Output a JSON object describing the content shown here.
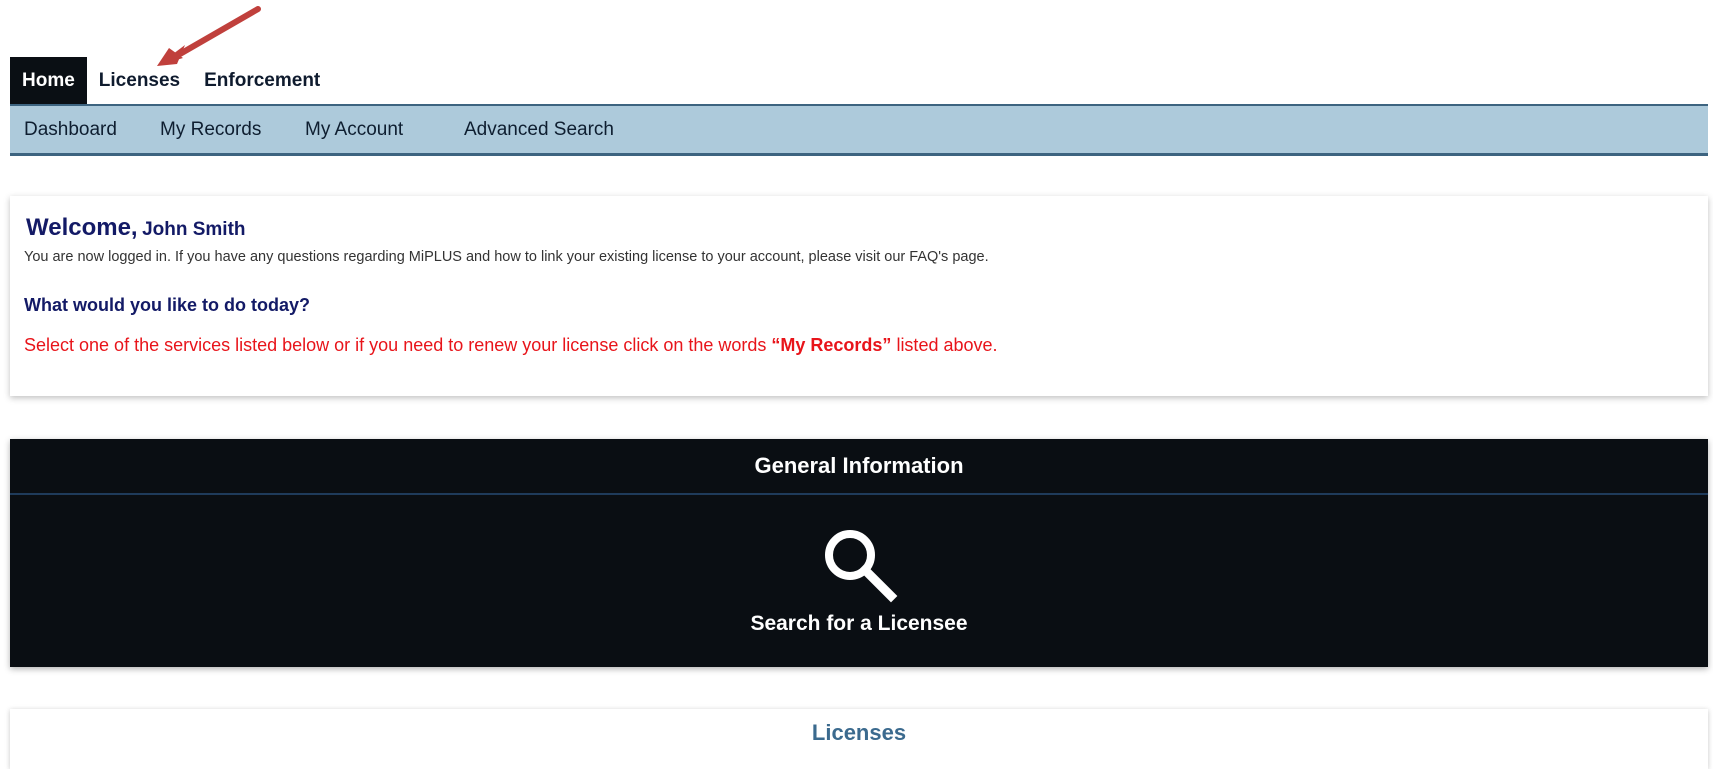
{
  "top_tabs": [
    "Home",
    "Licenses",
    "Enforcement"
  ],
  "sub_nav": [
    "Dashboard",
    "My Records",
    "My Account",
    "Advanced Search"
  ],
  "welcome": {
    "greeting": "Welcome,",
    "name": "John Smith",
    "message": "You are now logged in. If you have any questions regarding MiPLUS and how to link your existing license to your account, please visit our FAQ's page.",
    "question": "What would you like to do today?",
    "instruction_pre": "Select one of the services listed below or if you need to renew your license click on the words ",
    "instruction_bold": "“My Records”",
    "instruction_post": " listed above."
  },
  "general_info": {
    "title": "General Information",
    "search_label": "Search for a Licensee",
    "icon": "search-icon"
  },
  "licenses_panel": {
    "title": "Licenses"
  },
  "colors": {
    "nav_bg": "#adcadb",
    "dark_panel": "#0a0e13",
    "heading_blue": "#131a66",
    "alert_red": "#e8141a",
    "arrow": "#c0403c"
  }
}
